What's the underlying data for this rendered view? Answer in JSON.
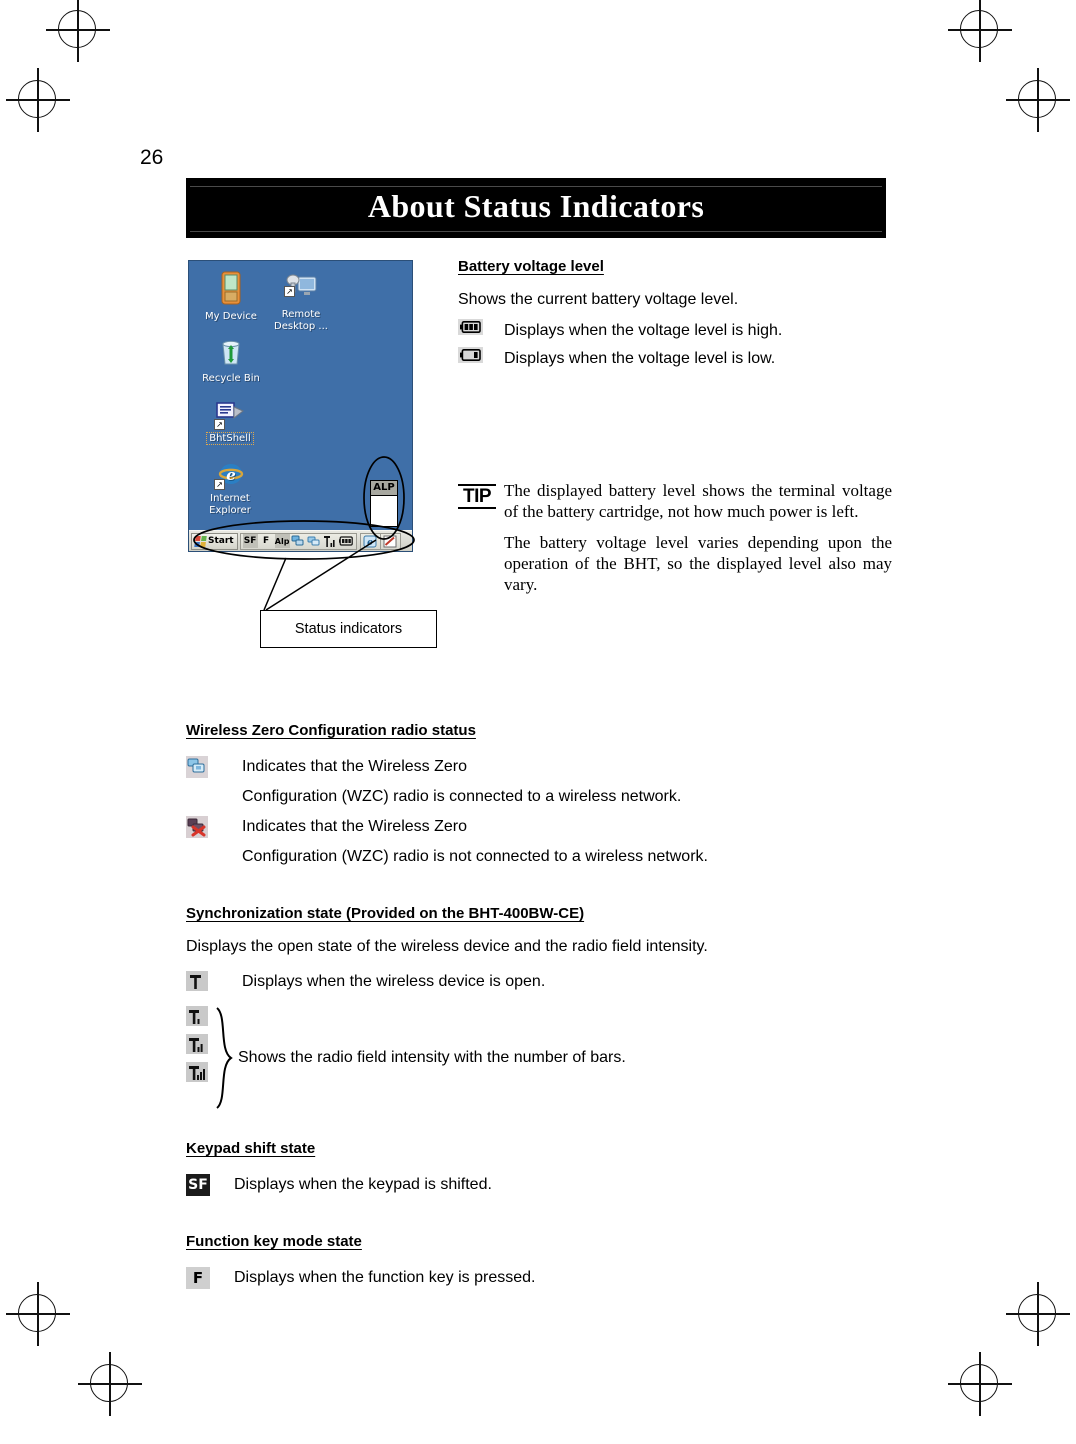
{
  "page": {
    "number": "26",
    "title": "About Status Indicators"
  },
  "device_screenshot": {
    "desktop_icons": [
      {
        "label": "My Device",
        "icon": "handheld-terminal-icon",
        "shortcut": false
      },
      {
        "label": "Remote Desktop ...",
        "icon": "remote-desktop-icon",
        "shortcut": true
      },
      {
        "label": "Recycle Bin",
        "icon": "recycle-bin-icon",
        "shortcut": false
      },
      {
        "label": "BhtShell",
        "icon": "bhtshell-icon",
        "shortcut": true
      },
      {
        "label": "Internet Explorer",
        "icon": "internet-explorer-icon",
        "shortcut": true
      }
    ],
    "taskbar": {
      "start_label": "Start",
      "tray_indicators": [
        {
          "name": "shift-indicator",
          "label": "SF"
        },
        {
          "name": "function-key-indicator",
          "label": "F"
        },
        {
          "name": "alpha-mode-indicator",
          "label": "Alp"
        },
        {
          "name": "network-connection-icon",
          "label": ""
        },
        {
          "name": "wireless-zero-config-icon",
          "label": ""
        },
        {
          "name": "signal-strength-icon",
          "label": ""
        },
        {
          "name": "battery-icon",
          "label": ""
        }
      ],
      "extra_buttons": [
        {
          "name": "input-panel-button",
          "label": ""
        },
        {
          "name": "desktop-button",
          "label": ""
        }
      ]
    },
    "popup": {
      "name": "alp-popup",
      "label": "ALP"
    }
  },
  "callout": {
    "label": "Status indicators"
  },
  "battery_section": {
    "heading": "Battery voltage level",
    "intro": "Shows the current battery voltage level.",
    "rows": [
      {
        "icon": "battery-full-icon",
        "text": "Displays when the voltage level is high."
      },
      {
        "icon": "battery-low-icon",
        "text": "Displays when the voltage level is low."
      }
    ]
  },
  "tip": {
    "mark": "TIP",
    "paragraphs": [
      "The displayed battery level shows the terminal voltage of the battery cartridge, not how much power is left.",
      "The battery voltage level varies depending upon the operation of the BHT, so the displayed level also may vary."
    ]
  },
  "wzc_section": {
    "heading": "Wireless Zero Configuration radio status",
    "rows": [
      {
        "icon": "wzc-connected-icon",
        "text": "Indicates that the Wireless Zero",
        "continuation": "Configuration (WZC) radio is connected to a wireless network."
      },
      {
        "icon": "wzc-disconnected-icon",
        "text": "Indicates that the Wireless Zero",
        "continuation": "Configuration (WZC) radio is not connected to a wireless network."
      }
    ]
  },
  "sync_section": {
    "heading": "Synchronization state (Provided on the BHT-400BW-CE)",
    "intro": "Displays the open state of the wireless device and the radio field intensity.",
    "open_row": {
      "icon": "antenna-open-icon",
      "text": "Displays when the wireless device is open."
    },
    "bars_group": {
      "icons": [
        "signal-1-bar-icon",
        "signal-2-bars-icon",
        "signal-3-bars-icon"
      ],
      "text": "Shows the radio field intensity with the number of bars."
    }
  },
  "keypad_section": {
    "heading": "Keypad shift state",
    "row": {
      "icon": "shift-sf-icon",
      "badge": "SF",
      "text": "Displays when the keypad is shifted."
    }
  },
  "function_section": {
    "heading": "Function key mode state",
    "row": {
      "icon": "function-f-icon",
      "badge": "F",
      "text": "Displays when the function key is pressed."
    }
  },
  "colors": {
    "banner_background": "#000000",
    "banner_text": "#ffffff",
    "desktop_background": "#3f6fa8",
    "taskbar_background": "#d8d8d0",
    "body_text": "#000000"
  }
}
